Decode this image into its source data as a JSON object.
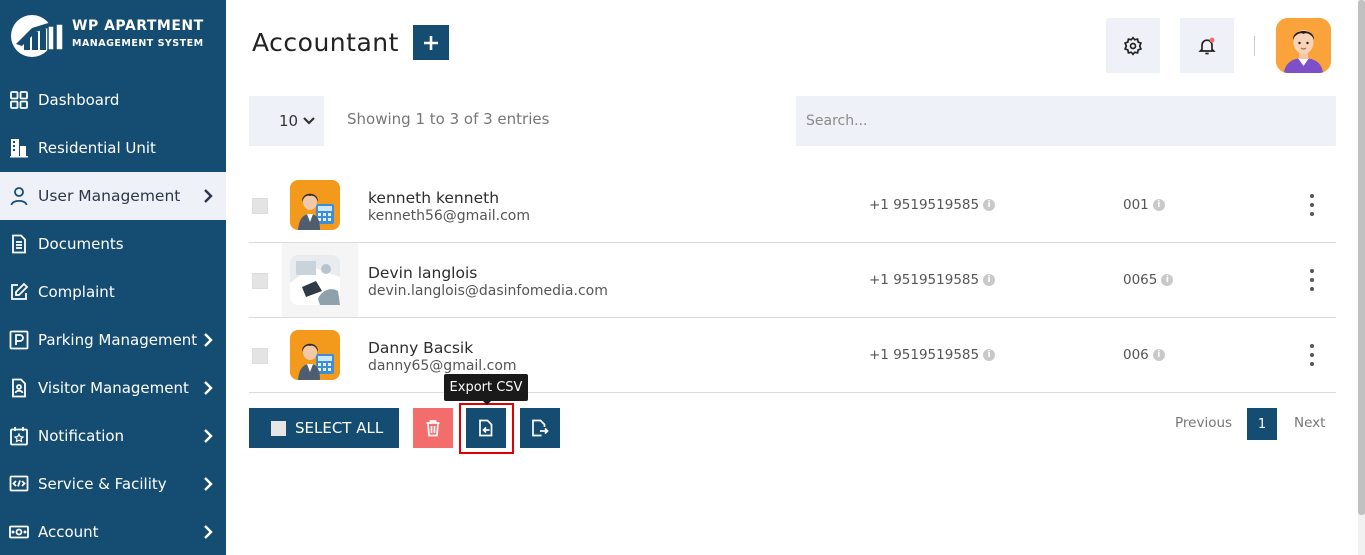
{
  "app": {
    "logo_title": "WP APARTMENT",
    "logo_subtitle": "MANAGEMENT SYSTEM"
  },
  "sidebar": {
    "items": [
      {
        "label": "Dashboard",
        "icon": "dashboard-grid-icon",
        "has_chevron": false,
        "active": false
      },
      {
        "label": "Residential Unit",
        "icon": "building-icon",
        "has_chevron": false,
        "active": false
      },
      {
        "label": "User Management",
        "icon": "user-icon",
        "has_chevron": true,
        "active": true
      },
      {
        "label": "Documents",
        "icon": "document-icon",
        "has_chevron": false,
        "active": false
      },
      {
        "label": "Complaint",
        "icon": "edit-icon",
        "has_chevron": false,
        "active": false
      },
      {
        "label": "Parking Management",
        "icon": "parking-icon",
        "has_chevron": true,
        "active": false
      },
      {
        "label": "Visitor Management",
        "icon": "visitor-icon",
        "has_chevron": true,
        "active": false
      },
      {
        "label": "Notification",
        "icon": "calendar-star-icon",
        "has_chevron": true,
        "active": false
      },
      {
        "label": "Service & Facility",
        "icon": "service-icon",
        "has_chevron": true,
        "active": false
      },
      {
        "label": "Account",
        "icon": "money-icon",
        "has_chevron": true,
        "active": false
      }
    ]
  },
  "header": {
    "title": "Accountant",
    "add_icon": "plus-icon",
    "settings_icon": "gear-icon",
    "notification_icon": "bell-icon"
  },
  "table_controls": {
    "page_size": "10",
    "entries_info": "Showing 1 to 3 of 3 entries",
    "search_placeholder": "Search..."
  },
  "rows": [
    {
      "name": "kenneth kenneth",
      "email": "kenneth56@gmail.com",
      "phone": "+1 9519519585",
      "code": "001",
      "avatar": "accountant-avatar"
    },
    {
      "name": "Devin langlois",
      "email": "devin.langlois@dasinfomedia.com",
      "phone": "+1 9519519585",
      "code": "0065",
      "avatar": "photo-avatar"
    },
    {
      "name": "Danny Bacsik",
      "email": "danny65@gmail.com",
      "phone": "+1 9519519585",
      "code": "006",
      "avatar": "accountant-avatar"
    }
  ],
  "actions": {
    "select_all": "SELECT ALL",
    "tooltip": "Export CSV"
  },
  "pagination": {
    "previous": "Previous",
    "current": "1",
    "next": "Next"
  },
  "colors": {
    "primary": "#154d72",
    "danger": "#f36d6d",
    "highlight": "#e00000",
    "light_bg": "#eef1f7"
  }
}
